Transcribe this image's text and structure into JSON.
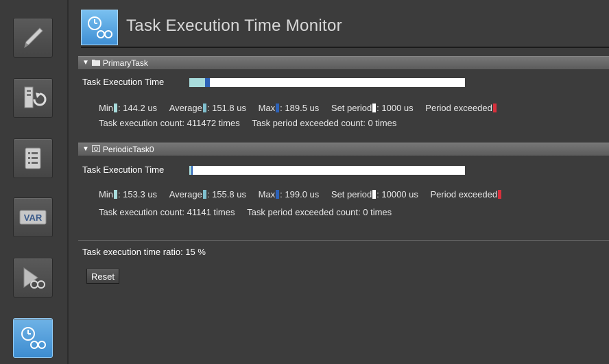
{
  "app": {
    "title": "Task Execution Time Monitor"
  },
  "sidebar": {
    "items": [
      {
        "icon": "pencil-icon"
      },
      {
        "icon": "transfer-icon"
      },
      {
        "icon": "list-icon"
      },
      {
        "icon": "var-icon",
        "label": "VAR"
      },
      {
        "icon": "simulation-monitor-icon"
      },
      {
        "icon": "task-time-monitor-icon",
        "active": true
      }
    ]
  },
  "colors": {
    "min": "#a8dcdc",
    "average": "#9bd0d8",
    "max": "#2d62b8",
    "set_period": "#ffffff",
    "period_exceeded": "#d8303c",
    "active_blue": "#4a9ad8"
  },
  "tasks": [
    {
      "name": "PrimaryTask",
      "exec_time_label": "Task Execution Time",
      "bar": {
        "min_us": 144.2,
        "average_us": 151.8,
        "max_us": 189.5,
        "set_period_us": 1000
      },
      "min_label": "Min",
      "min_value": ": 144.2 us",
      "average_label": "Average",
      "average_value": ": 151.8 us",
      "max_label": "Max",
      "max_value": ": 189.5 us",
      "set_period_label": "Set period",
      "set_period_value": ": 1000 us",
      "period_exceeded_label": "Period exceeded",
      "exec_count_label": "Task execution count",
      "exec_count_value": ": 411472 times",
      "exceeded_count_label": "Task period exceeded count",
      "exceeded_count_value": ": 0 times"
    },
    {
      "name": "PeriodicTask0",
      "exec_time_label": "Task Execution Time",
      "bar": {
        "min_us": 153.3,
        "average_us": 155.8,
        "max_us": 199.0,
        "set_period_us": 10000
      },
      "min_label": "Min",
      "min_value": ": 153.3 us",
      "average_label": "Average",
      "average_value": ": 155.8 us",
      "max_label": "Max",
      "max_value": ": 199.0 us",
      "set_period_label": "Set period",
      "set_period_value": ": 10000 us",
      "period_exceeded_label": "Period exceeded",
      "exec_count_label": "Task execution count",
      "exec_count_value": ": 41141 times",
      "exceeded_count_label": "Task period exceeded count",
      "exceeded_count_value": ": 0 times"
    }
  ],
  "ratio": {
    "label": "Task execution time ratio",
    "value": ": 15 %"
  },
  "reset_label": "Reset"
}
